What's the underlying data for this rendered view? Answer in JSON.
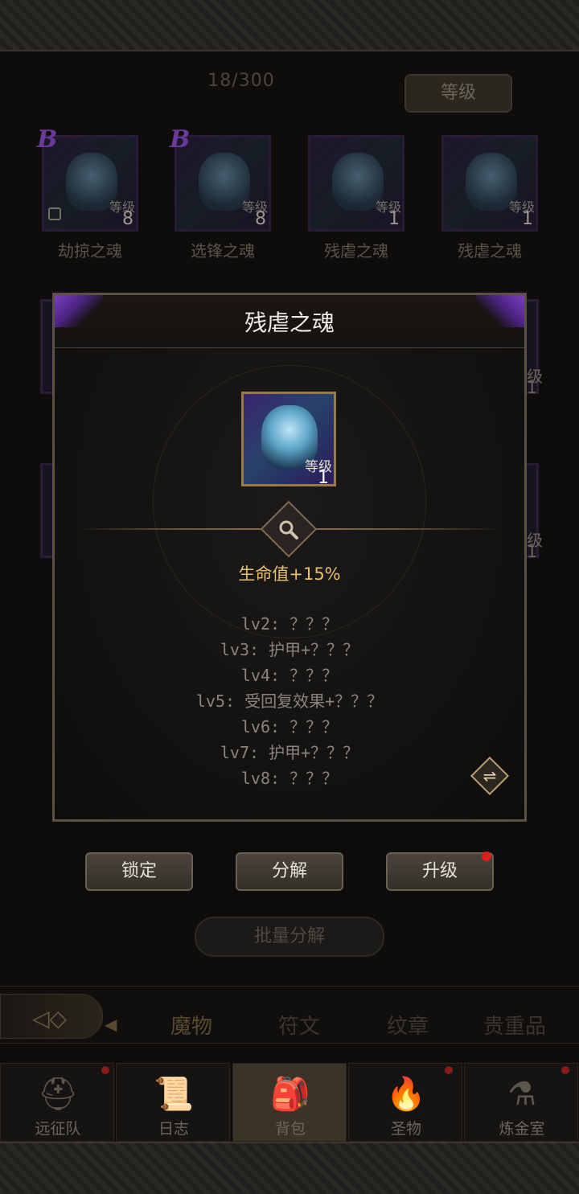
{
  "inventory": {
    "count": "18/300",
    "sort_label": "等级"
  },
  "slots": [
    {
      "name": "劫掠之魂",
      "level_label": "等级",
      "level": "8",
      "rarity": "B",
      "locked": true
    },
    {
      "name": "选锋之魂",
      "level_label": "等级",
      "level": "8",
      "rarity": "B",
      "locked": false
    },
    {
      "name": "残虐之魂",
      "level_label": "等级",
      "level": "1",
      "rarity": "",
      "locked": false
    },
    {
      "name": "残虐之魂",
      "level_label": "等级",
      "level": "1",
      "rarity": "",
      "locked": false
    }
  ],
  "ghost_right": {
    "level_label_1": "级",
    "level_1": "1",
    "level_label_2": "级",
    "level_2": "1"
  },
  "detail": {
    "title": "残虐之魂",
    "icon": {
      "level_label": "等级",
      "level": "1",
      "icon_name": "beast-soul-icon"
    },
    "main_stat": "生命值+15%",
    "levels": [
      "lv2: ？？？",
      "lv3: 护甲+？？？",
      "lv4: ？？？",
      "lv5: 受回复效果+？？？",
      "lv6: ？？？",
      "lv7: 护甲+？？？",
      "lv8: ？？？"
    ]
  },
  "actions": {
    "lock": "锁定",
    "decompose": "分解",
    "upgrade": "升级",
    "batch_decompose": "批量分解"
  },
  "tabs": [
    "魔物",
    "符文",
    "纹章",
    "贵重品"
  ],
  "nav": [
    {
      "label": "远征队",
      "icon": "helmet-icon"
    },
    {
      "label": "日志",
      "icon": "scroll-icon"
    },
    {
      "label": "背包",
      "icon": "backpack-icon"
    },
    {
      "label": "圣物",
      "icon": "torch-icon"
    },
    {
      "label": "炼金室",
      "icon": "alchemy-icon"
    }
  ],
  "colors": {
    "accent_gold": "#e8c070",
    "rarity_purple": "#7a3fc0",
    "notify_red": "#d8201c"
  }
}
